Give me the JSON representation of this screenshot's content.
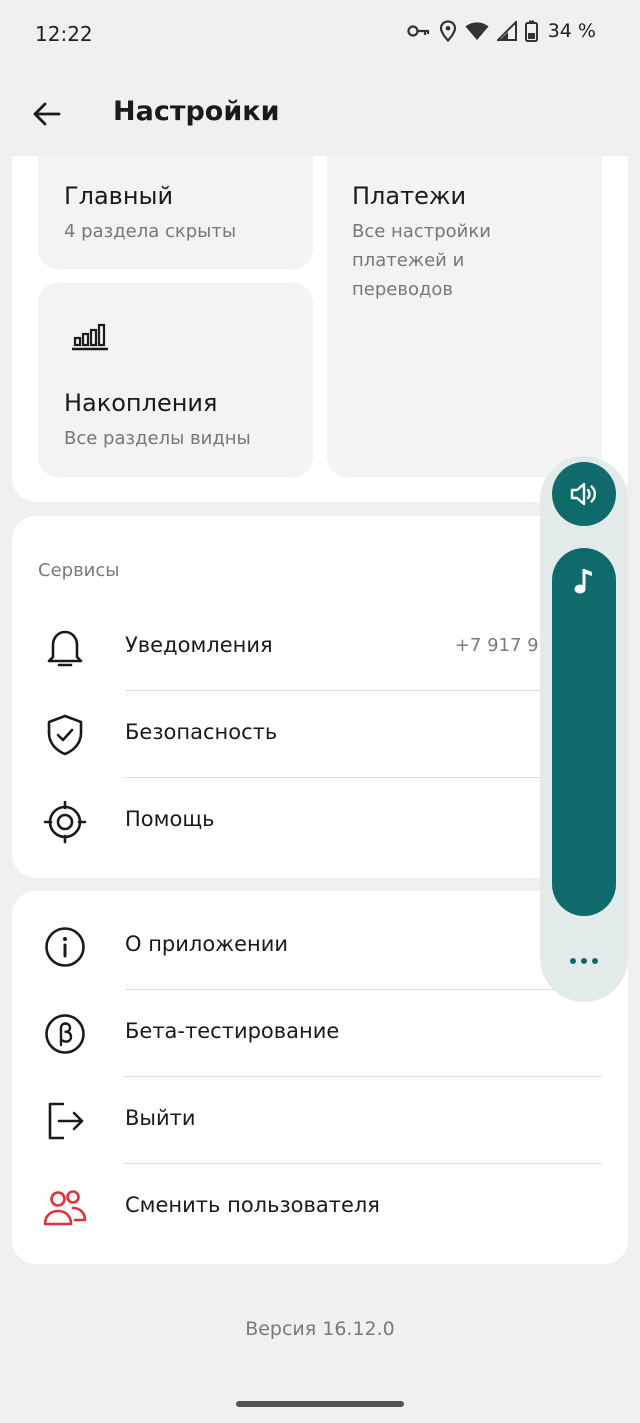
{
  "status_bar": {
    "time": "12:22",
    "battery": "34 %",
    "icons": [
      "vpn-key-icon",
      "location-icon",
      "wifi-icon",
      "signal-icon",
      "battery-icon"
    ]
  },
  "app_bar": {
    "title": "Настройки",
    "back_icon": "arrow-left-icon"
  },
  "tiles": {
    "main": {
      "title": "Главный",
      "subtitle": "4 раздела скрыты"
    },
    "payments": {
      "title": "Платежи",
      "subtitle_lines": [
        "Все настройки",
        "платежей и",
        "переводов"
      ]
    },
    "savings": {
      "title": "Накопления",
      "subtitle": "Все разделы видны",
      "icon": "bar-chart-icon"
    }
  },
  "services": {
    "label": "Сервисы",
    "items": [
      {
        "label": "Уведомления",
        "value": "+7 917 969-",
        "icon": "bell-icon"
      },
      {
        "label": "Безопасность",
        "value": "",
        "icon": "shield-check-icon"
      },
      {
        "label": "Помощь",
        "value": "",
        "icon": "lifebuoy-icon"
      }
    ]
  },
  "app_items": [
    {
      "label": "О приложении",
      "icon": "info-icon"
    },
    {
      "label": "Бета-тестирование",
      "icon": "beta-icon"
    },
    {
      "label": "Выйти",
      "icon": "logout-icon"
    },
    {
      "label": "Сменить пользователя",
      "icon": "users-icon"
    }
  ],
  "version": "Версия 16.12.0",
  "volume_overlay": {
    "icons": [
      "speaker-icon",
      "music-note-icon",
      "more-icon"
    ],
    "accent_color": "#0f6b6b",
    "panel_color": "#e3ebea"
  },
  "colors": {
    "background": "#f0f0f0",
    "card": "#ffffff",
    "tile": "#f3f3f3",
    "switch_user_icon": "#e0303a"
  }
}
